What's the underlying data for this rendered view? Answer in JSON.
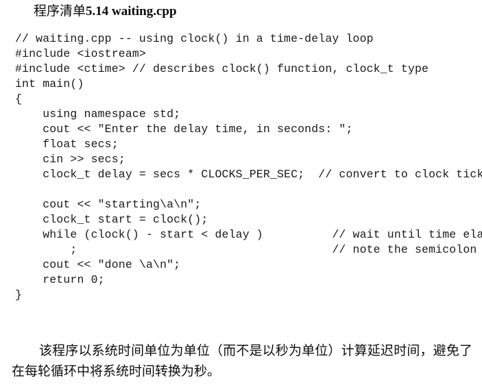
{
  "document": {
    "title_cjk": "程序清单",
    "title_latin": "5.14 waiting.cpp",
    "title_full": "程序清单5.14 waiting.cpp"
  },
  "code": {
    "language": "cpp",
    "lines": [
      "// waiting.cpp -- using clock() in a time-delay loop",
      "#include <iostream>",
      "#include <ctime> // describes clock() function, clock_t type",
      "int main()",
      "{",
      "    using namespace std;",
      "    cout << \"Enter the delay time, in seconds: \";",
      "    float secs;",
      "    cin >> secs;",
      "    clock_t delay = secs * CLOCKS_PER_SEC;  // convert to clock ticks",
      "",
      "    cout << \"starting\\a\\n\";",
      "    clock_t start = clock();",
      "    while (clock() - start < delay )          // wait until time elapses",
      "        ;                                     // note the semicolon",
      "    cout << \"done \\a\\n\";",
      "    return 0;",
      "}"
    ]
  },
  "paragraph": {
    "text": "该程序以系统时间单位为单位（而不是以秒为单位）计算延迟时间，避免了在每轮循环中将系统时间转换为秒。"
  },
  "colors": {
    "page_background": "#ffffff",
    "text": "#000000",
    "code_text": "#1a1a1a"
  }
}
